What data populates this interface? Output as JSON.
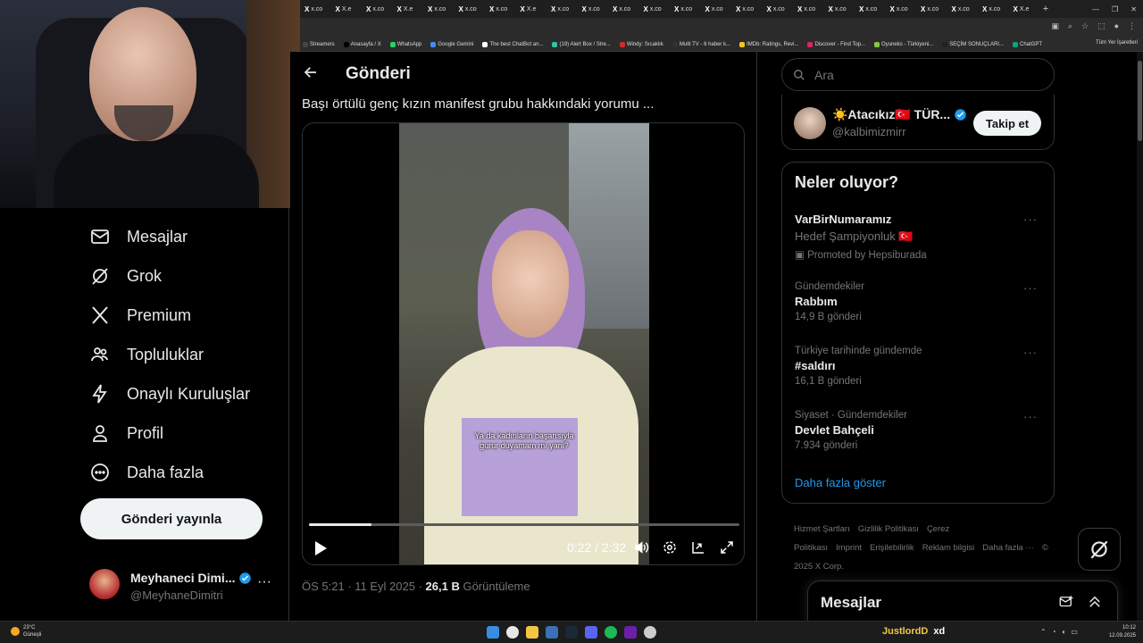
{
  "browser": {
    "tabs": [
      "X",
      "X",
      "X",
      "X",
      "X",
      "X",
      "X",
      "X",
      "X",
      "X",
      "X",
      "X",
      "X",
      "X",
      "X",
      "X",
      "X",
      "X",
      "X",
      "X",
      "X",
      "X",
      "X",
      "X"
    ],
    "tab_texts": [
      "x.co",
      "X.e",
      "x.co",
      "X.e",
      "x.co",
      "x.co",
      "x.co",
      "X.e",
      "x.co",
      "x.co",
      "x.co",
      "x.co",
      "x.co",
      "x.co",
      "x.co",
      "x.co",
      "x.co",
      "x.co",
      "x.co",
      "x.co",
      "x.co",
      "x.co",
      "x.co",
      "X.e"
    ],
    "bookmarks": [
      {
        "label": "Streamers",
        "color": "#444444"
      },
      {
        "label": "Anasayfa / X",
        "color": "#000000"
      },
      {
        "label": "WhatsApp",
        "color": "#25d366"
      },
      {
        "label": "Google Gemini",
        "color": "#4a8af4"
      },
      {
        "label": "The best ChatBot an...",
        "color": "#ffffff"
      },
      {
        "label": "(19) Alert Box / Stre...",
        "color": "#31c3a2"
      },
      {
        "label": "Windy: Sıcaklık",
        "color": "#d12c2c"
      },
      {
        "label": "Multi TV - 6 haber k...",
        "color": "#333333"
      },
      {
        "label": "IMDb: Ratings, Revi...",
        "color": "#f5c518"
      },
      {
        "label": "Discover - Find Top...",
        "color": "#e0245e"
      },
      {
        "label": "Oyuneks - Türkiyeni...",
        "color": "#8bc34a"
      },
      {
        "label": "SEÇİM SONUÇLARI...",
        "color": "#222222"
      },
      {
        "label": "ChatGPT",
        "color": "#10a37f"
      }
    ],
    "bookmarks_right": "Tüm Yer İşaretleri"
  },
  "nav": {
    "items": [
      {
        "label": "Mesajlar",
        "icon": "mail-icon"
      },
      {
        "label": "Grok",
        "icon": "grok-icon"
      },
      {
        "label": "Premium",
        "icon": "x-logo-icon"
      },
      {
        "label": "Topluluklar",
        "icon": "communities-icon"
      },
      {
        "label": "Onaylı Kuruluşlar",
        "icon": "lightning-icon"
      },
      {
        "label": "Profil",
        "icon": "profile-icon"
      },
      {
        "label": "Daha fazla",
        "icon": "more-circle-icon"
      }
    ],
    "post_button": "Gönderi yayınla",
    "account": {
      "name": "Meyhaneci Dimi...",
      "handle": "@MeyhaneDimitri"
    }
  },
  "main": {
    "title": "Gönderi",
    "post_text": "Başı örtülü genç kızın manifest grubu hakkındaki yorumu ...",
    "video": {
      "caption": "Ya da kadınların başarısıyla gurur duyamam mı yani?",
      "current_time": "0:22",
      "duration": "2:32",
      "progress_fraction": 0.145
    },
    "meta": {
      "time": "ÖS 5:21",
      "date": "11 Eyl 2025",
      "views": "26,1 B",
      "views_label": "Görüntüleme"
    }
  },
  "right": {
    "search_placeholder": "Ara",
    "follow": {
      "name": "☀️Atacıkız🇹🇷 TÜR...",
      "handle": "@kalbimizmirr",
      "button": "Takip et"
    },
    "trends_title": "Neler oluyor?",
    "trends": [
      {
        "context": "",
        "name": "VarBirNumaramız",
        "count": "",
        "extra": "Hedef Şampiyonluk 🇹🇷",
        "promoted": "Promoted by Hepsiburada"
      },
      {
        "context": "Gündemdekiler",
        "name": "Rabbım",
        "count": "14,9 B gönderi"
      },
      {
        "context": "Türkiye tarihinde gündemde",
        "name": "#saldırı",
        "count": "16,1 B gönderi"
      },
      {
        "context": "Siyaset · Gündemdekiler",
        "name": "Devlet Bahçeli",
        "count": "7.934 gönderi"
      }
    ],
    "show_more": "Daha fazla göster",
    "footer": [
      "Hizmet Şartları",
      "Gizlilik Politikası",
      "Çerez Politikası",
      "Imprint",
      "Erişilebilirlik",
      "Reklam bilgisi",
      "Daha fazla ···",
      "© 2025 X Corp."
    ],
    "messages_dock": "Mesajlar"
  },
  "taskbar": {
    "weather_temp": "23°C",
    "weather_desc": "Güneşli",
    "user": "JustlordD",
    "user_suffix": "xd",
    "time": "10:12",
    "date": "12.09.2025"
  },
  "colors": {
    "accent": "#1d9bf0",
    "background": "#000000",
    "border": "#2f3336",
    "secondary_text": "#71767b"
  }
}
